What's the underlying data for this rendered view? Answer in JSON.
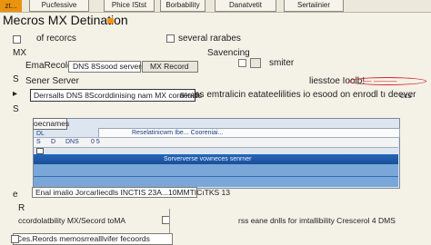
{
  "tabs": {
    "orange": "zt...",
    "t1": "Pucfessive",
    "t2": "Phice IStst",
    "t3": "Borbability",
    "t4": "Danatvetit",
    "t5": "Sertaiinier"
  },
  "header": {
    "title": "Mecros MX Detination"
  },
  "rows": {
    "mx_label": "MX",
    "records_text": "of recorcs",
    "several_text": "several rarabes",
    "emrecord_label": "EmaRecold",
    "dns_field": "DNS 8Ssood servers",
    "mx_record_btn": "MX Record",
    "sevencing": "Savencing",
    "smiter": "smiter",
    "s_label": "S",
    "server_label": "Sener Server",
    "right_hint": "liesstoe Ioolb!",
    "red_value": "— ———",
    "desc_field": "Derrsalls DNS 8Scorddinising nam MX cornendls",
    "pct": "8%%",
    "long_desc": "as emtralicin eatateelilities io esood on enrodl tı deever",
    "ccs": "ccs",
    "s2_label": "S",
    "e_label": "e"
  },
  "grid": {
    "head": "oecnames",
    "r1_dl": "DL",
    "r1_s": "S",
    "r1_d": "D",
    "r1_dns": "DNS",
    "r1_cell": "Reselatinicwm Ibe... Cooreniai...",
    "r1_ds": "0 5",
    "selected_text": "Sorververse vowneces senrner"
  },
  "bottom": {
    "enal_field": "Enal imalio Jorcarliecdls INCTIS 23A...10MMTICıTKS 13",
    "r_label": "R",
    "cordo": "ccordolatbility MX/Secord toMA",
    "right_text": "rss eane dnlls for imtallibility Crescerol  4 DMS",
    "bottom_field": "Ces.Reords  memosrrealllvifer fecoords"
  },
  "colors": {
    "accent_orange": "#e9930f",
    "selection_blue": "#1f5aa8",
    "highlight_red": "#d3262a",
    "background": "#f4f1e7"
  }
}
